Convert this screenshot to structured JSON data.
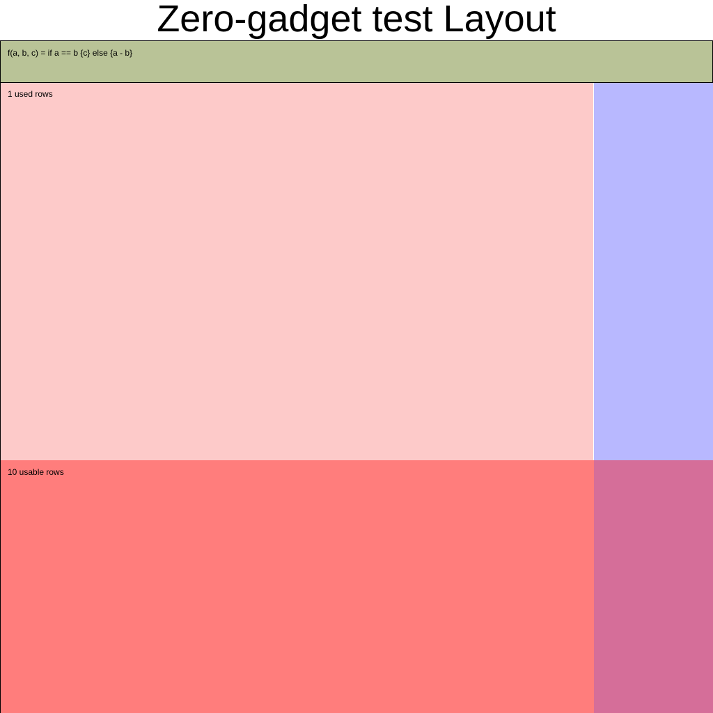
{
  "title": "Zero-gadget test Layout",
  "formula": {
    "text": "f(a, b, c) = if a == b {c} else {a - b}",
    "color": "#b9c397"
  },
  "used_rows": {
    "label": "1 used rows",
    "color": "#fdcac9",
    "side_color": "#b8b8ff"
  },
  "usable_rows": {
    "label": "10 usable rows",
    "color": "#ff7d7c",
    "side_color": "#d56e99"
  }
}
